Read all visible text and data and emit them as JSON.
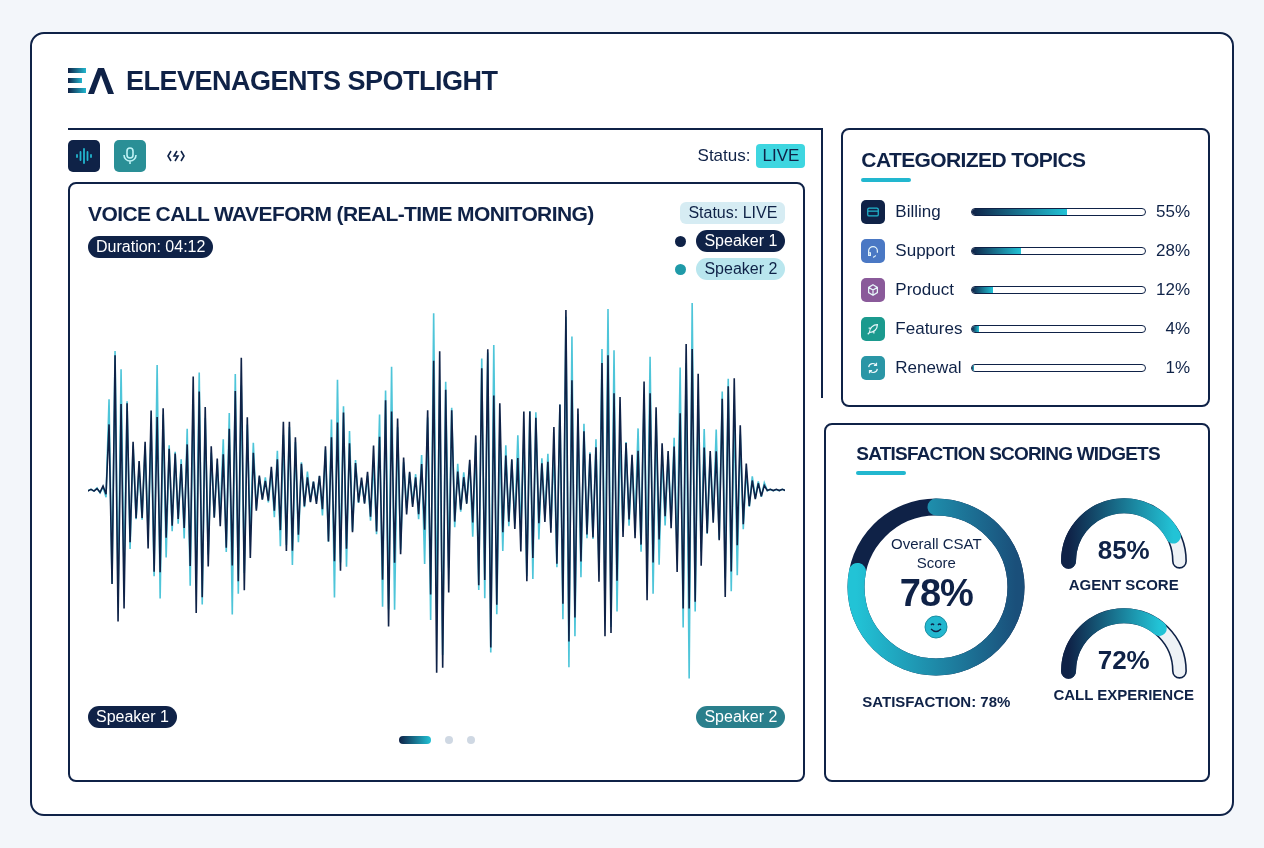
{
  "header": {
    "title": "ELEVENAGENTS SPOTLIGHT"
  },
  "toolbar": {
    "tools": [
      {
        "kind": "filled"
      },
      {
        "kind": "tinted"
      },
      {
        "kind": "plain"
      }
    ],
    "status_label": "Status:",
    "status_value": "LIVE"
  },
  "waveform": {
    "title": "VOICE CALL WAVEFORM (REAL-TIME MONITORING)",
    "status": "Status: LIVE",
    "duration": "Duration: 04:12",
    "legend": [
      {
        "label": "Speaker 1",
        "color": "#0f2247"
      },
      {
        "label": "Speaker 2",
        "color": "#1f9aa8"
      }
    ],
    "bottom_labels": [
      {
        "label": "Speaker 1",
        "color": "#0f2247"
      },
      {
        "label": "Speaker 2",
        "color": "#2a7f8c"
      }
    ],
    "pages": [
      {
        "selected": true
      },
      {
        "selected": false
      },
      {
        "selected": false
      }
    ]
  },
  "topics": {
    "title": "CATEGORIZED TOPICS",
    "items": [
      {
        "label": "Billing",
        "level": 0.55,
        "value": "55%",
        "color": "#0f2247"
      },
      {
        "label": "Support",
        "level": 0.28,
        "value": "28%",
        "color": "#4a78c4"
      },
      {
        "label": "Product",
        "level": 0.12,
        "value": "12%",
        "color": "#8a5a9a"
      },
      {
        "label": "Features",
        "level": 0.04,
        "value": "4%",
        "color": "#1b9a8e"
      },
      {
        "label": "Renewal",
        "level": 0.01,
        "value": "1%",
        "color": "#2a96a6"
      }
    ]
  },
  "satisfaction": {
    "title": "SATISFACTION SCORING WIDGETS",
    "overall": {
      "label": "Overall CSAT Score",
      "value": "78%",
      "level": 0.78
    },
    "caption": "SATISFACTION: 78%",
    "gauges": [
      {
        "value": "85%",
        "label": "AGENT SCORE"
      },
      {
        "value": "72%",
        "label": "CALL EXPERIENCE"
      }
    ]
  }
}
